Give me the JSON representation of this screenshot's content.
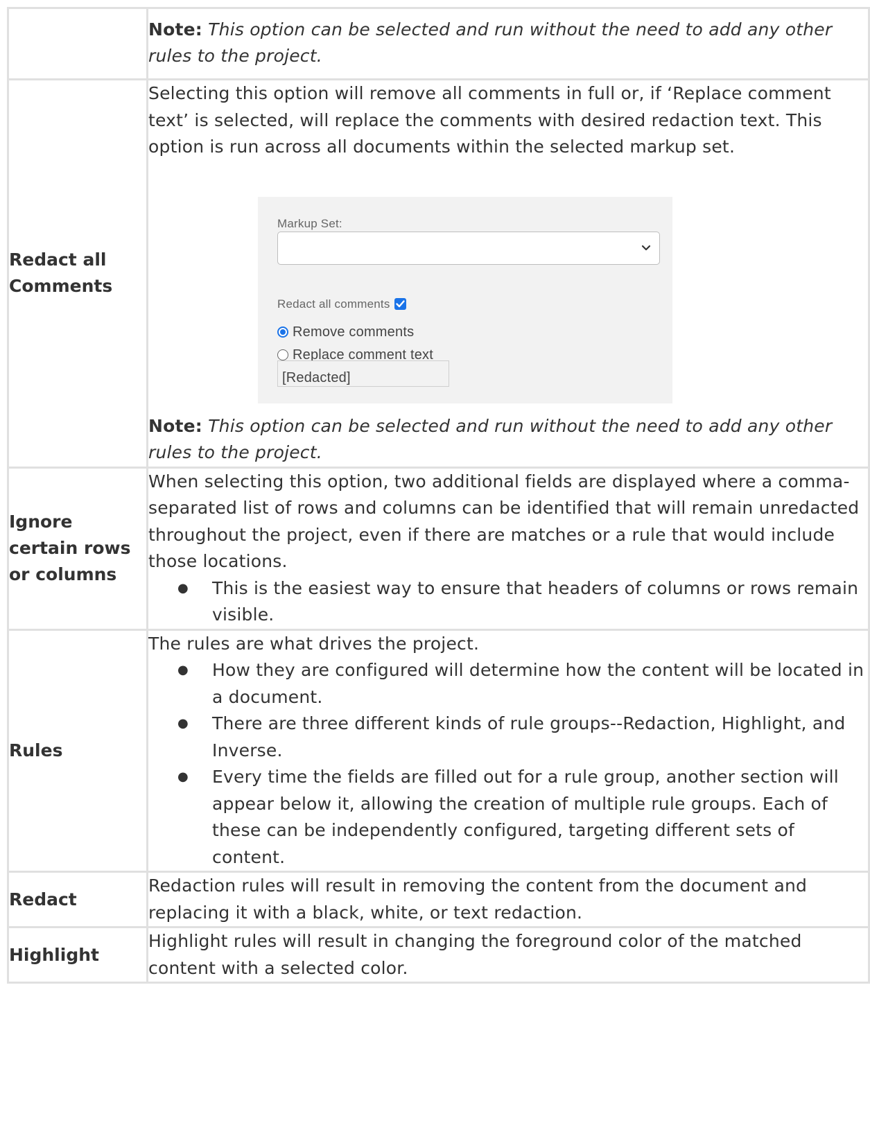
{
  "note": {
    "label": "Note:",
    "text": "This option can be selected and run without the need to add any other rules to the project."
  },
  "rows": {
    "comments": {
      "label": "Redact all Comments",
      "text": "Selecting this option will remove all comments in full or, if ‘Replace comment text’ is selected,  will replace the comments with desired redaction text. This option is run across all documents within the selected markup set.",
      "panel": {
        "markup_set_label": "Markup Set:",
        "markup_set_value": "",
        "redact_all_label": "Redact all comments",
        "redact_all_checked": true,
        "remove_label": "Remove comments",
        "replace_label": "Replace comment text",
        "selected_option": "Remove comments",
        "replacement_text": "[Redacted]"
      }
    },
    "ignore": {
      "label": "Ignore certain rows or columns",
      "text": "When selecting this option, two additional fields are displayed where a comma-separated list of rows and columns can be identified that will remain unredacted throughout the project, even if there are matches or a rule that would include those locations.",
      "bullets": [
        "This is the easiest way to ensure that headers of columns or rows remain visible."
      ]
    },
    "rules": {
      "label": "Rules",
      "text": "The rules are what drives the project.",
      "bullets": [
        "How they are configured will determine how the content will be located in a document.",
        "There are three different kinds of rule groups--Redaction, Highlight, and Inverse.",
        "Every time the fields are filled out for a rule group, another section will appear below it, allowing the creation of multiple rule groups. Each of these can be independently configured, targeting different sets of content."
      ]
    },
    "redact": {
      "label": "Redact",
      "text": "Redaction rules will result in removing the content from the document and replacing it with a black, white, or text redaction."
    },
    "highlight": {
      "label": "Highlight",
      "text": "Highlight rules will result in changing the foreground color of the matched content with a selected color."
    }
  },
  "colors": {
    "text": "#333333",
    "border": "#e0e0e0",
    "accent": "#1a73e8",
    "panel_bg": "#f2f2f2"
  }
}
